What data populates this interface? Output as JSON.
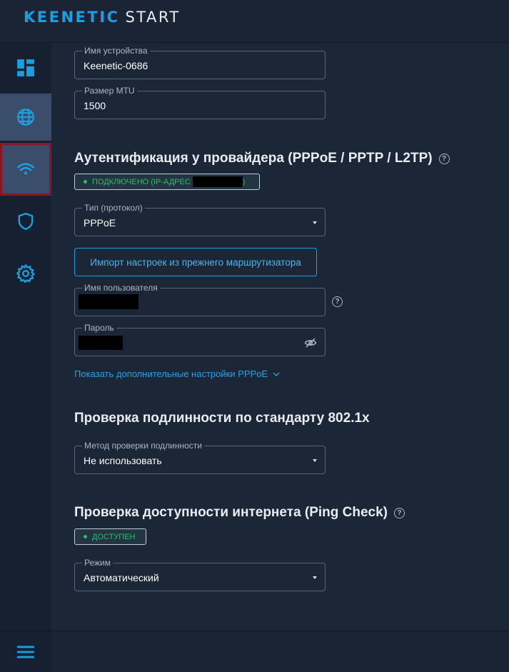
{
  "header": {
    "brand": "KEENETIC",
    "product": "START"
  },
  "sidebar": {
    "items": [
      {
        "icon": "dashboard-icon"
      },
      {
        "icon": "globe-icon"
      },
      {
        "icon": "wifi-icon"
      },
      {
        "icon": "shield-icon"
      },
      {
        "icon": "gear-icon"
      }
    ],
    "menu_icon": "menu-icon"
  },
  "fields": {
    "device_name": {
      "label": "Имя устройства",
      "value": "Keenetic-0686"
    },
    "mtu": {
      "label": "Размер MTU",
      "value": "1500"
    }
  },
  "auth": {
    "title": "Аутентификация у провайдера (PPPoE / PPTP / L2TP)",
    "status_prefix": "ПОДКЛЮЧЕНО (IP-АДРЕС",
    "status_suffix": ")",
    "protocol": {
      "label": "Тип (протокол)",
      "value": "PPPoE"
    },
    "import_button": "Импорт настроек из прежнего маршрутизатора",
    "username": {
      "label": "Имя пользователя"
    },
    "password": {
      "label": "Пароль"
    },
    "more_settings": "Показать дополнительные настройки PPPoE"
  },
  "dot1x": {
    "title": "Проверка подлинности по стандарту 802.1x",
    "method": {
      "label": "Метод проверки подлинности",
      "value": "Не использовать"
    }
  },
  "ping": {
    "title": "Проверка доступности интернета (Ping Check)",
    "status": "ДОСТУПЕН",
    "mode": {
      "label": "Режим",
      "value": "Автоматический"
    }
  },
  "colors": {
    "accent": "#1a9fe0",
    "status_green": "#2ebd5e",
    "highlight_border": "#8a1624"
  }
}
